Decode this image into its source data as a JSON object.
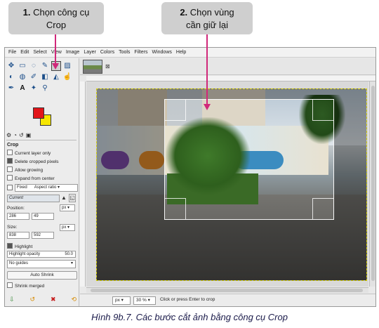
{
  "callouts": {
    "step1": {
      "num": "1.",
      "line1": "Chọn công cụ",
      "line2": "Crop"
    },
    "step2": {
      "num": "2.",
      "line1": "Chọn vùng",
      "line2": "cần giữ lại"
    }
  },
  "menubar": [
    "File",
    "Edit",
    "Select",
    "View",
    "Image",
    "Layer",
    "Colors",
    "Tools",
    "Filters",
    "Windows",
    "Help"
  ],
  "tool_options": {
    "title": "Crop",
    "current_layer_only": "Current layer only",
    "delete_cropped_pixels": "Delete cropped pixels",
    "allow_growing": "Allow growing",
    "expand_from_center": "Expand from center",
    "fixed_label": "Fixed",
    "fixed_mode": "Aspect ratio",
    "current_label": "Current",
    "position_label": "Position:",
    "position_x": "286",
    "position_y": "49",
    "position_unit": "px",
    "size_label": "Size:",
    "size_w": "838",
    "size_h": "592",
    "size_unit": "px",
    "highlight": "Highlight",
    "highlight_opacity_label": "Highlight opacity",
    "highlight_opacity_value": "50.0",
    "guides": "No guides",
    "auto_shrink": "Auto Shrink",
    "shrink_merged": "Shrink merged"
  },
  "status": {
    "unit": "px",
    "zoom": "30 %",
    "message": "Click or press Enter to crop"
  },
  "caption": "Hình 9b.7. Các bước cắt ảnh bằng công cụ Crop",
  "colors": {
    "callout_bg": "#cfcfcf",
    "arrow": "#d1287a",
    "foreground": "#e2151a",
    "background": "#f6e600"
  }
}
